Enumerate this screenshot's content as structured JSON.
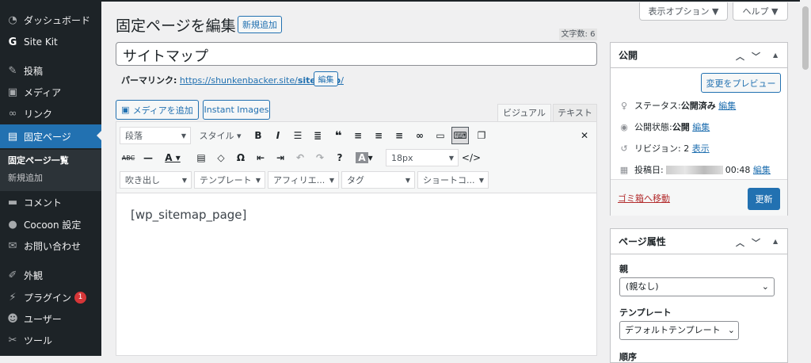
{
  "sidebar": {
    "items": [
      {
        "label": "ダッシュボード",
        "icon": "dashboard-icon"
      },
      {
        "label": "Site Kit",
        "icon": "google-g-icon"
      },
      {
        "label": "投稿",
        "icon": "pin-icon"
      },
      {
        "label": "メディア",
        "icon": "media-icon"
      },
      {
        "label": "リンク",
        "icon": "link-icon"
      },
      {
        "label": "固定ページ",
        "icon": "page-icon"
      },
      {
        "label": "コメント",
        "icon": "comment-icon"
      },
      {
        "label": "Cocoon 設定",
        "icon": "cocoon-icon"
      },
      {
        "label": "お問い合わせ",
        "icon": "mail-icon"
      },
      {
        "label": "外観",
        "icon": "brush-icon"
      },
      {
        "label": "プラグイン",
        "icon": "plugin-icon",
        "badge": "1"
      },
      {
        "label": "ユーザー",
        "icon": "user-icon"
      },
      {
        "label": "ツール",
        "icon": "wrench-icon"
      }
    ],
    "submenu": [
      "固定ページ一覧",
      "新規追加"
    ]
  },
  "header": {
    "title": "固定ページを編集",
    "add_new": "新規追加",
    "screen_options": "表示オプション ▼",
    "help": "ヘルプ ▼"
  },
  "editor": {
    "word_count": "文字数: 6",
    "post_title": "サイトマップ",
    "permalink_label": "パーマリンク:",
    "permalink_base": "https://shunkenbacker.site/",
    "permalink_slug": "site-map",
    "permalink_tail": "/",
    "permalink_edit": "編集",
    "add_media": "メディアを追加",
    "instant_images": "Instant Images",
    "tab_visual": "ビジュアル",
    "tab_text": "テキスト",
    "format_select": "段落",
    "style_select": "スタイル ▾",
    "font_size": "18px",
    "dropdowns": [
      "吹き出し",
      "テンプレート",
      "アフィリエ...",
      "タグ",
      "ショートコ..."
    ],
    "content": "[wp_sitemap_page]"
  },
  "publish": {
    "title": "公開",
    "preview": "変更をプレビュー",
    "status_label": "ステータス: ",
    "status_value": "公開済み",
    "status_edit": "編集",
    "visibility_label": "公開状態: ",
    "visibility_value": "公開",
    "visibility_edit": "編集",
    "revisions_label": "リビジョン: 2",
    "revisions_link": "表示",
    "date_label": "投稿日: ",
    "date_value": "00:48",
    "date_edit": "編集",
    "trash": "ゴミ箱へ移動",
    "update": "更新"
  },
  "attributes": {
    "title": "ページ属性",
    "parent_label": "親",
    "parent_value": "(親なし)",
    "template_label": "テンプレート",
    "template_value": "デフォルトテンプレート",
    "order_label": "順序"
  },
  "colors": {
    "accent": "#2271b1",
    "sidebar": "#1d2327",
    "badge": "#d63638",
    "trash": "#b32d2e"
  }
}
